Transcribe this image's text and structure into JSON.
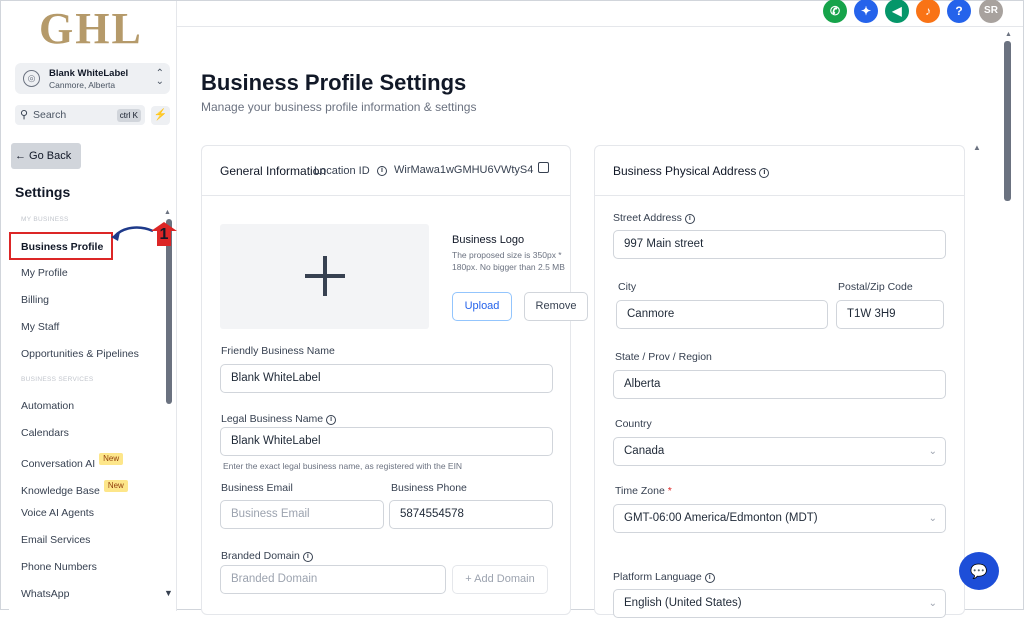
{
  "sidebar": {
    "logo": "GHL",
    "account": {
      "name": "Blank WhiteLabel",
      "location": "Canmore, Alberta"
    },
    "search": {
      "label": "Search",
      "shortcut": "ctrl K"
    },
    "go_back": "← Go Back",
    "settings_title": "Settings",
    "section_my_business": "MY BUSINESS",
    "section_business_services": "BUSINESS SERVICES",
    "items": [
      {
        "label": "Business Profile",
        "active": true
      },
      {
        "label": "My Profile"
      },
      {
        "label": "Billing"
      },
      {
        "label": "My Staff"
      },
      {
        "label": "Opportunities & Pipelines"
      },
      {
        "label": "Automation"
      },
      {
        "label": "Calendars"
      },
      {
        "label": "Conversation AI",
        "badge": "New"
      },
      {
        "label": "Knowledge Base",
        "badge": "New"
      },
      {
        "label": "Voice AI Agents"
      },
      {
        "label": "Email Services"
      },
      {
        "label": "Phone Numbers"
      },
      {
        "label": "WhatsApp"
      }
    ],
    "annotation_number": "1"
  },
  "topbar": {
    "icons": [
      {
        "name": "phone-icon",
        "color": "#16a34a",
        "glyph": "✆"
      },
      {
        "name": "sparkle-icon",
        "color": "#2563eb",
        "glyph": "✦"
      },
      {
        "name": "megaphone-icon",
        "color": "#059669",
        "glyph": "📣"
      },
      {
        "name": "bell-icon",
        "color": "#f97316",
        "glyph": "🔔"
      },
      {
        "name": "help-icon",
        "color": "#2563eb",
        "glyph": "?"
      },
      {
        "name": "avatar-icon",
        "color": "#a8a29e",
        "glyph": "SR"
      }
    ]
  },
  "main": {
    "title": "Business Profile Settings",
    "subtitle": "Manage your business profile information & settings"
  },
  "general": {
    "title": "General Information",
    "location_id_label": "Location ID",
    "location_id": "WirMawa1wGMHU6VWtyS4",
    "logo_label": "Business Logo",
    "logo_hint": "The proposed size is 350px * 180px. No bigger than 2.5 MB",
    "upload": "Upload",
    "remove": "Remove",
    "friendly_name_label": "Friendly Business Name",
    "friendly_name": "Blank WhiteLabel",
    "legal_name_label": "Legal Business Name",
    "legal_name": "Blank WhiteLabel",
    "legal_name_hint": "Enter the exact legal business name, as registered with the EIN",
    "email_label": "Business Email",
    "email_placeholder": "Business Email",
    "phone_label": "Business Phone",
    "phone": "5874554578",
    "domain_label": "Branded Domain",
    "domain_placeholder": "Branded Domain",
    "add_domain": "+ Add Domain"
  },
  "address": {
    "title": "Business Physical Address",
    "street_label": "Street Address",
    "street": "997 Main street",
    "city_label": "City",
    "city": "Canmore",
    "postal_label": "Postal/Zip Code",
    "postal": "T1W 3H9",
    "state_label": "State / Prov / Region",
    "state": "Alberta",
    "country_label": "Country",
    "country": "Canada",
    "timezone_label": "Time Zone",
    "timezone_required": "*",
    "timezone": "GMT-06:00 America/Edmonton (MDT)",
    "language_label": "Platform Language",
    "language": "English (United States)"
  }
}
